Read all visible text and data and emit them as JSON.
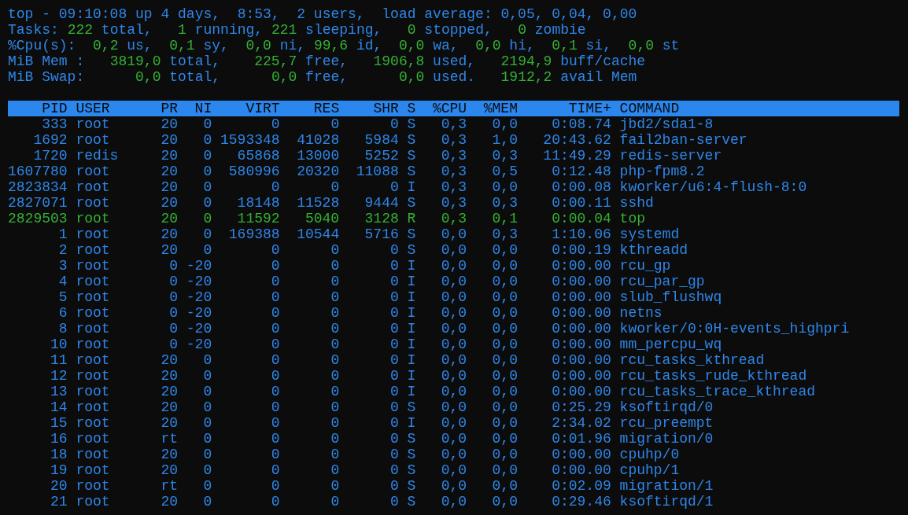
{
  "summary": [
    [
      {
        "kind": "label",
        "text": "top - 09:10:08 up 4 days,  8:53,  2 users,  load average: 0,05, 0,04, 0,00"
      }
    ],
    [
      {
        "kind": "label",
        "text": "Tasks: "
      },
      {
        "kind": "value",
        "text": "222"
      },
      {
        "kind": "label",
        "text": " total,   "
      },
      {
        "kind": "value",
        "text": "1"
      },
      {
        "kind": "label",
        "text": " running, "
      },
      {
        "kind": "value",
        "text": "221"
      },
      {
        "kind": "label",
        "text": " sleeping,   "
      },
      {
        "kind": "value",
        "text": "0"
      },
      {
        "kind": "label",
        "text": " stopped,   "
      },
      {
        "kind": "value",
        "text": "0"
      },
      {
        "kind": "label",
        "text": " zombie"
      }
    ],
    [
      {
        "kind": "label",
        "text": "%Cpu(s):  "
      },
      {
        "kind": "value",
        "text": "0,2"
      },
      {
        "kind": "label",
        "text": " us,  "
      },
      {
        "kind": "value",
        "text": "0,1"
      },
      {
        "kind": "label",
        "text": " sy,  "
      },
      {
        "kind": "value",
        "text": "0,0"
      },
      {
        "kind": "label",
        "text": " ni, "
      },
      {
        "kind": "value",
        "text": "99,6"
      },
      {
        "kind": "label",
        "text": " id,  "
      },
      {
        "kind": "value",
        "text": "0,0"
      },
      {
        "kind": "label",
        "text": " wa,  "
      },
      {
        "kind": "value",
        "text": "0,0"
      },
      {
        "kind": "label",
        "text": " hi,  "
      },
      {
        "kind": "value",
        "text": "0,1"
      },
      {
        "kind": "label",
        "text": " si,  "
      },
      {
        "kind": "value",
        "text": "0,0"
      },
      {
        "kind": "label",
        "text": " st"
      }
    ],
    [
      {
        "kind": "label",
        "text": "MiB Mem :   "
      },
      {
        "kind": "value",
        "text": "3819,0"
      },
      {
        "kind": "label",
        "text": " total,    "
      },
      {
        "kind": "value",
        "text": "225,7"
      },
      {
        "kind": "label",
        "text": " free,   "
      },
      {
        "kind": "value",
        "text": "1906,8"
      },
      {
        "kind": "label",
        "text": " used,   "
      },
      {
        "kind": "value",
        "text": "2194,9"
      },
      {
        "kind": "label",
        "text": " buff/cache"
      }
    ],
    [
      {
        "kind": "label",
        "text": "MiB Swap:      "
      },
      {
        "kind": "value",
        "text": "0,0"
      },
      {
        "kind": "label",
        "text": " total,      "
      },
      {
        "kind": "value",
        "text": "0,0"
      },
      {
        "kind": "label",
        "text": " free,      "
      },
      {
        "kind": "value",
        "text": "0,0"
      },
      {
        "kind": "label",
        "text": " used.   "
      },
      {
        "kind": "value",
        "text": "1912,2"
      },
      {
        "kind": "label",
        "text": " avail Mem"
      }
    ]
  ],
  "table": {
    "columns": [
      "PID",
      "USER",
      "PR",
      "NI",
      "VIRT",
      "RES",
      "SHR",
      "S",
      "%CPU",
      "%MEM",
      "TIME+",
      "COMMAND"
    ],
    "rows": [
      {
        "highlighted": false,
        "cells": [
          "333",
          "root",
          "20",
          "0",
          "0",
          "0",
          "0",
          "S",
          "0,3",
          "0,0",
          "0:08.74",
          "jbd2/sda1-8"
        ]
      },
      {
        "highlighted": false,
        "cells": [
          "1692",
          "root",
          "20",
          "0",
          "1593348",
          "41028",
          "5984",
          "S",
          "0,3",
          "1,0",
          "20:43.62",
          "fail2ban-server"
        ]
      },
      {
        "highlighted": false,
        "cells": [
          "1720",
          "redis",
          "20",
          "0",
          "65868",
          "13000",
          "5252",
          "S",
          "0,3",
          "0,3",
          "11:49.29",
          "redis-server"
        ]
      },
      {
        "highlighted": false,
        "cells": [
          "1607780",
          "root",
          "20",
          "0",
          "580996",
          "20320",
          "11088",
          "S",
          "0,3",
          "0,5",
          "0:12.48",
          "php-fpm8.2"
        ]
      },
      {
        "highlighted": false,
        "cells": [
          "2823834",
          "root",
          "20",
          "0",
          "0",
          "0",
          "0",
          "I",
          "0,3",
          "0,0",
          "0:00.08",
          "kworker/u6:4-flush-8:0"
        ]
      },
      {
        "highlighted": false,
        "cells": [
          "2827071",
          "root",
          "20",
          "0",
          "18148",
          "11528",
          "9444",
          "S",
          "0,3",
          "0,3",
          "0:00.11",
          "sshd"
        ]
      },
      {
        "highlighted": true,
        "cells": [
          "2829503",
          "root",
          "20",
          "0",
          "11592",
          "5040",
          "3128",
          "R",
          "0,3",
          "0,1",
          "0:00.04",
          "top"
        ]
      },
      {
        "highlighted": false,
        "cells": [
          "1",
          "root",
          "20",
          "0",
          "169388",
          "10544",
          "5716",
          "S",
          "0,0",
          "0,3",
          "1:10.06",
          "systemd"
        ]
      },
      {
        "highlighted": false,
        "cells": [
          "2",
          "root",
          "20",
          "0",
          "0",
          "0",
          "0",
          "S",
          "0,0",
          "0,0",
          "0:00.19",
          "kthreadd"
        ]
      },
      {
        "highlighted": false,
        "cells": [
          "3",
          "root",
          "0",
          "-20",
          "0",
          "0",
          "0",
          "I",
          "0,0",
          "0,0",
          "0:00.00",
          "rcu_gp"
        ]
      },
      {
        "highlighted": false,
        "cells": [
          "4",
          "root",
          "0",
          "-20",
          "0",
          "0",
          "0",
          "I",
          "0,0",
          "0,0",
          "0:00.00",
          "rcu_par_gp"
        ]
      },
      {
        "highlighted": false,
        "cells": [
          "5",
          "root",
          "0",
          "-20",
          "0",
          "0",
          "0",
          "I",
          "0,0",
          "0,0",
          "0:00.00",
          "slub_flushwq"
        ]
      },
      {
        "highlighted": false,
        "cells": [
          "6",
          "root",
          "0",
          "-20",
          "0",
          "0",
          "0",
          "I",
          "0,0",
          "0,0",
          "0:00.00",
          "netns"
        ]
      },
      {
        "highlighted": false,
        "cells": [
          "8",
          "root",
          "0",
          "-20",
          "0",
          "0",
          "0",
          "I",
          "0,0",
          "0,0",
          "0:00.00",
          "kworker/0:0H-events_highpri"
        ]
      },
      {
        "highlighted": false,
        "cells": [
          "10",
          "root",
          "0",
          "-20",
          "0",
          "0",
          "0",
          "I",
          "0,0",
          "0,0",
          "0:00.00",
          "mm_percpu_wq"
        ]
      },
      {
        "highlighted": false,
        "cells": [
          "11",
          "root",
          "20",
          "0",
          "0",
          "0",
          "0",
          "I",
          "0,0",
          "0,0",
          "0:00.00",
          "rcu_tasks_kthread"
        ]
      },
      {
        "highlighted": false,
        "cells": [
          "12",
          "root",
          "20",
          "0",
          "0",
          "0",
          "0",
          "I",
          "0,0",
          "0,0",
          "0:00.00",
          "rcu_tasks_rude_kthread"
        ]
      },
      {
        "highlighted": false,
        "cells": [
          "13",
          "root",
          "20",
          "0",
          "0",
          "0",
          "0",
          "I",
          "0,0",
          "0,0",
          "0:00.00",
          "rcu_tasks_trace_kthread"
        ]
      },
      {
        "highlighted": false,
        "cells": [
          "14",
          "root",
          "20",
          "0",
          "0",
          "0",
          "0",
          "S",
          "0,0",
          "0,0",
          "0:25.29",
          "ksoftirqd/0"
        ]
      },
      {
        "highlighted": false,
        "cells": [
          "15",
          "root",
          "20",
          "0",
          "0",
          "0",
          "0",
          "I",
          "0,0",
          "0,0",
          "2:34.02",
          "rcu_preempt"
        ]
      },
      {
        "highlighted": false,
        "cells": [
          "16",
          "root",
          "rt",
          "0",
          "0",
          "0",
          "0",
          "S",
          "0,0",
          "0,0",
          "0:01.96",
          "migration/0"
        ]
      },
      {
        "highlighted": false,
        "cells": [
          "18",
          "root",
          "20",
          "0",
          "0",
          "0",
          "0",
          "S",
          "0,0",
          "0,0",
          "0:00.00",
          "cpuhp/0"
        ]
      },
      {
        "highlighted": false,
        "cells": [
          "19",
          "root",
          "20",
          "0",
          "0",
          "0",
          "0",
          "S",
          "0,0",
          "0,0",
          "0:00.00",
          "cpuhp/1"
        ]
      },
      {
        "highlighted": false,
        "cells": [
          "20",
          "root",
          "rt",
          "0",
          "0",
          "0",
          "0",
          "S",
          "0,0",
          "0,0",
          "0:02.09",
          "migration/1"
        ]
      },
      {
        "highlighted": false,
        "cells": [
          "21",
          "root",
          "20",
          "0",
          "0",
          "0",
          "0",
          "S",
          "0,0",
          "0,0",
          "0:29.46",
          "ksoftirqd/1"
        ]
      }
    ]
  }
}
